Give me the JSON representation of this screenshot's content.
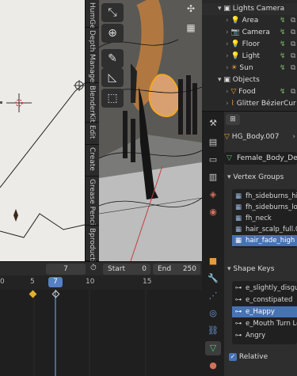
{
  "left_toolbar_tabs": [
    "HumGen",
    "Depth Manager",
    "BlenderKit",
    "Edit",
    "Create",
    "Grease Pencil",
    "Bproduction"
  ],
  "tools": [
    "move-icon",
    "transform-icon",
    "annotate-icon",
    "measure-icon",
    "add-cube-icon"
  ],
  "outliner": {
    "rows": [
      {
        "label": "Lights Camera",
        "indent": 0,
        "icon": "collection"
      },
      {
        "label": "Area",
        "indent": 1,
        "icon": "light"
      },
      {
        "label": "Camera",
        "indent": 1,
        "icon": "camera"
      },
      {
        "label": "Floor",
        "indent": 1,
        "icon": "light"
      },
      {
        "label": "Light",
        "indent": 1,
        "icon": "light"
      },
      {
        "label": "Sun",
        "indent": 1,
        "icon": "light"
      },
      {
        "label": "Objects",
        "indent": 0,
        "icon": "collection"
      },
      {
        "label": "Food",
        "indent": 1,
        "icon": "mesh"
      },
      {
        "label": "Glitter BézierCur",
        "indent": 1,
        "icon": "curve"
      }
    ]
  },
  "properties": {
    "object_name": "HG_Body.007",
    "mesh_name": "Female_Body_Det",
    "vertex_groups_title": "Vertex Groups",
    "vertex_groups": [
      "fh_sideburns_high",
      "fh_sideburns_low",
      "fh_neck",
      "hair_scalp_full.00",
      "hair_fade_high"
    ],
    "vertex_groups_selected": 4,
    "shape_keys_title": "Shape Keys",
    "shape_keys": [
      "e_slightly_disgust",
      "e_constipated",
      "e_Happy",
      "e_Mouth Turn Lef",
      "Angry"
    ],
    "shape_keys_selected": 2,
    "relative_label": "Relative",
    "relative_checked": true
  },
  "timeline": {
    "current_frame": "7",
    "start_label": "Start",
    "start_value": "0",
    "end_label": "End",
    "end_value": "250",
    "ruler_labels": [
      "0",
      "5",
      "7",
      "10",
      "15"
    ]
  },
  "colors": {
    "accent_blue": "#4772b3",
    "selection_orange": "#f5a623",
    "keyframe_yellow": "#e0b030",
    "playhead_blue": "#5680c2"
  }
}
